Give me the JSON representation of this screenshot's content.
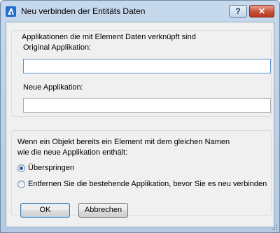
{
  "window": {
    "title": "Neu verbinden der Entitäts Daten",
    "help_label": "?",
    "close_label": "✕",
    "accent": "#2a5fa0"
  },
  "group1": {
    "legend": "Applikationen die mit Element Daten verknüpft sind",
    "original_label": "Original Applikation:",
    "original_value": "",
    "new_label": "Neue Applikation:",
    "new_value": ""
  },
  "group2": {
    "description_line1": "Wenn ein Objekt bereits ein Element mit dem gleichen Namen",
    "description_line2": "wie die neue Applikation enthält:",
    "options": [
      {
        "label": "Überspringen",
        "selected": true
      },
      {
        "label": "Entfernen Sie die bestehende Applikation, bevor Sie es neu verbinden",
        "selected": false
      }
    ]
  },
  "buttons": {
    "ok_label": "OK",
    "cancel_label": "Abbrechen"
  }
}
